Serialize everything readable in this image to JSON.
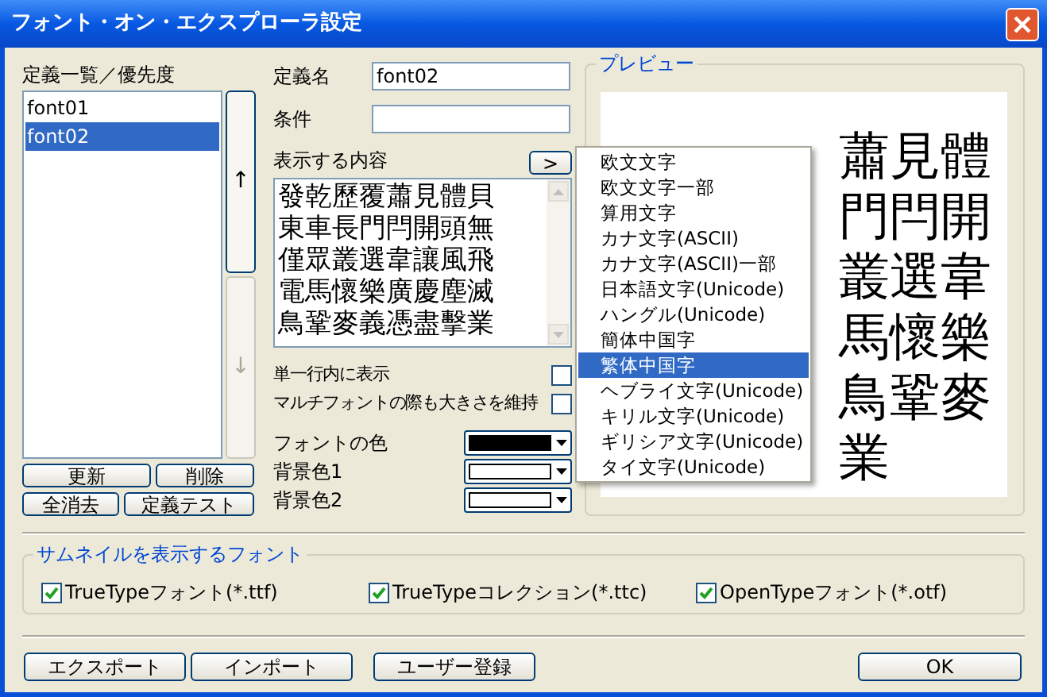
{
  "window": {
    "title": "フォント・オン・エクスプローラ設定"
  },
  "definitions": {
    "label": "定義一覧／優先度",
    "items": [
      {
        "name": "font01",
        "selected": false
      },
      {
        "name": "font02",
        "selected": true
      }
    ],
    "move_buttons": [
      {
        "label": "↑",
        "disabled": false
      },
      {
        "label": "↓",
        "disabled": true
      }
    ],
    "buttons": [
      "更新",
      "削除",
      "全消去",
      "定義テスト"
    ]
  },
  "fields": [
    {
      "label": "定義名",
      "value": "font02"
    },
    {
      "label": "条件"
    }
  ],
  "content": {
    "label": "表示する内容",
    "menu_button": ">",
    "lines": [
      "發乾歷覆蕭見體貝",
      "東車長門閂開頭無",
      "僅眾叢選韋讓風飛",
      "電馬懷樂廣慶塵滅",
      "鳥鞏麥義憑盡擊業"
    ]
  },
  "options": [
    {
      "label": "単一行内に表示",
      "checked": false
    },
    {
      "label": "マルチフォントの際も大きさを維持",
      "checked": false
    }
  ],
  "colors": [
    {
      "label": "フォントの色",
      "color": "#000000"
    },
    {
      "label": "背景色1",
      "color": "#ffffff"
    },
    {
      "label": "背景色2",
      "color": "#ffffff"
    }
  ],
  "preview": {
    "legend": "プレビュー",
    "rows": [
      "蕭見體",
      "門閂開",
      "叢選韋",
      "馬懷樂",
      "鳥鞏麥",
      "業"
    ]
  },
  "menu": {
    "items": [
      {
        "label": "欧文文字",
        "selected": false
      },
      {
        "label": "欧文文字一部",
        "selected": false
      },
      {
        "label": "算用文字",
        "selected": false
      },
      {
        "label": "カナ文字(ASCII)",
        "selected": false
      },
      {
        "label": "カナ文字(ASCII)一部",
        "selected": false
      },
      {
        "label": "日本語文字(Unicode)",
        "selected": false
      },
      {
        "label": "ハングル(Unicode)",
        "selected": false
      },
      {
        "label": "簡体中国字",
        "selected": false
      },
      {
        "label": "繁体中国字",
        "selected": true
      },
      {
        "label": "ヘブライ文字(Unicode)",
        "selected": false
      },
      {
        "label": "キリル文字(Unicode)",
        "selected": false
      },
      {
        "label": "ギリシア文字(Unicode)",
        "selected": false
      },
      {
        "label": "タイ文字(Unicode)",
        "selected": false
      }
    ]
  },
  "thumbnails": {
    "legend": "サムネイルを表示するフォント",
    "items": [
      {
        "label": "TrueTypeフォント(*.ttf)",
        "checked": true
      },
      {
        "label": "TrueTypeコレクション(*.ttc)",
        "checked": true
      },
      {
        "label": "OpenTypeフォント(*.otf)",
        "checked": true
      }
    ]
  },
  "footer": {
    "buttons": [
      "エクスポート",
      "インポート",
      "ユーザー登録"
    ],
    "ok": "OK"
  }
}
